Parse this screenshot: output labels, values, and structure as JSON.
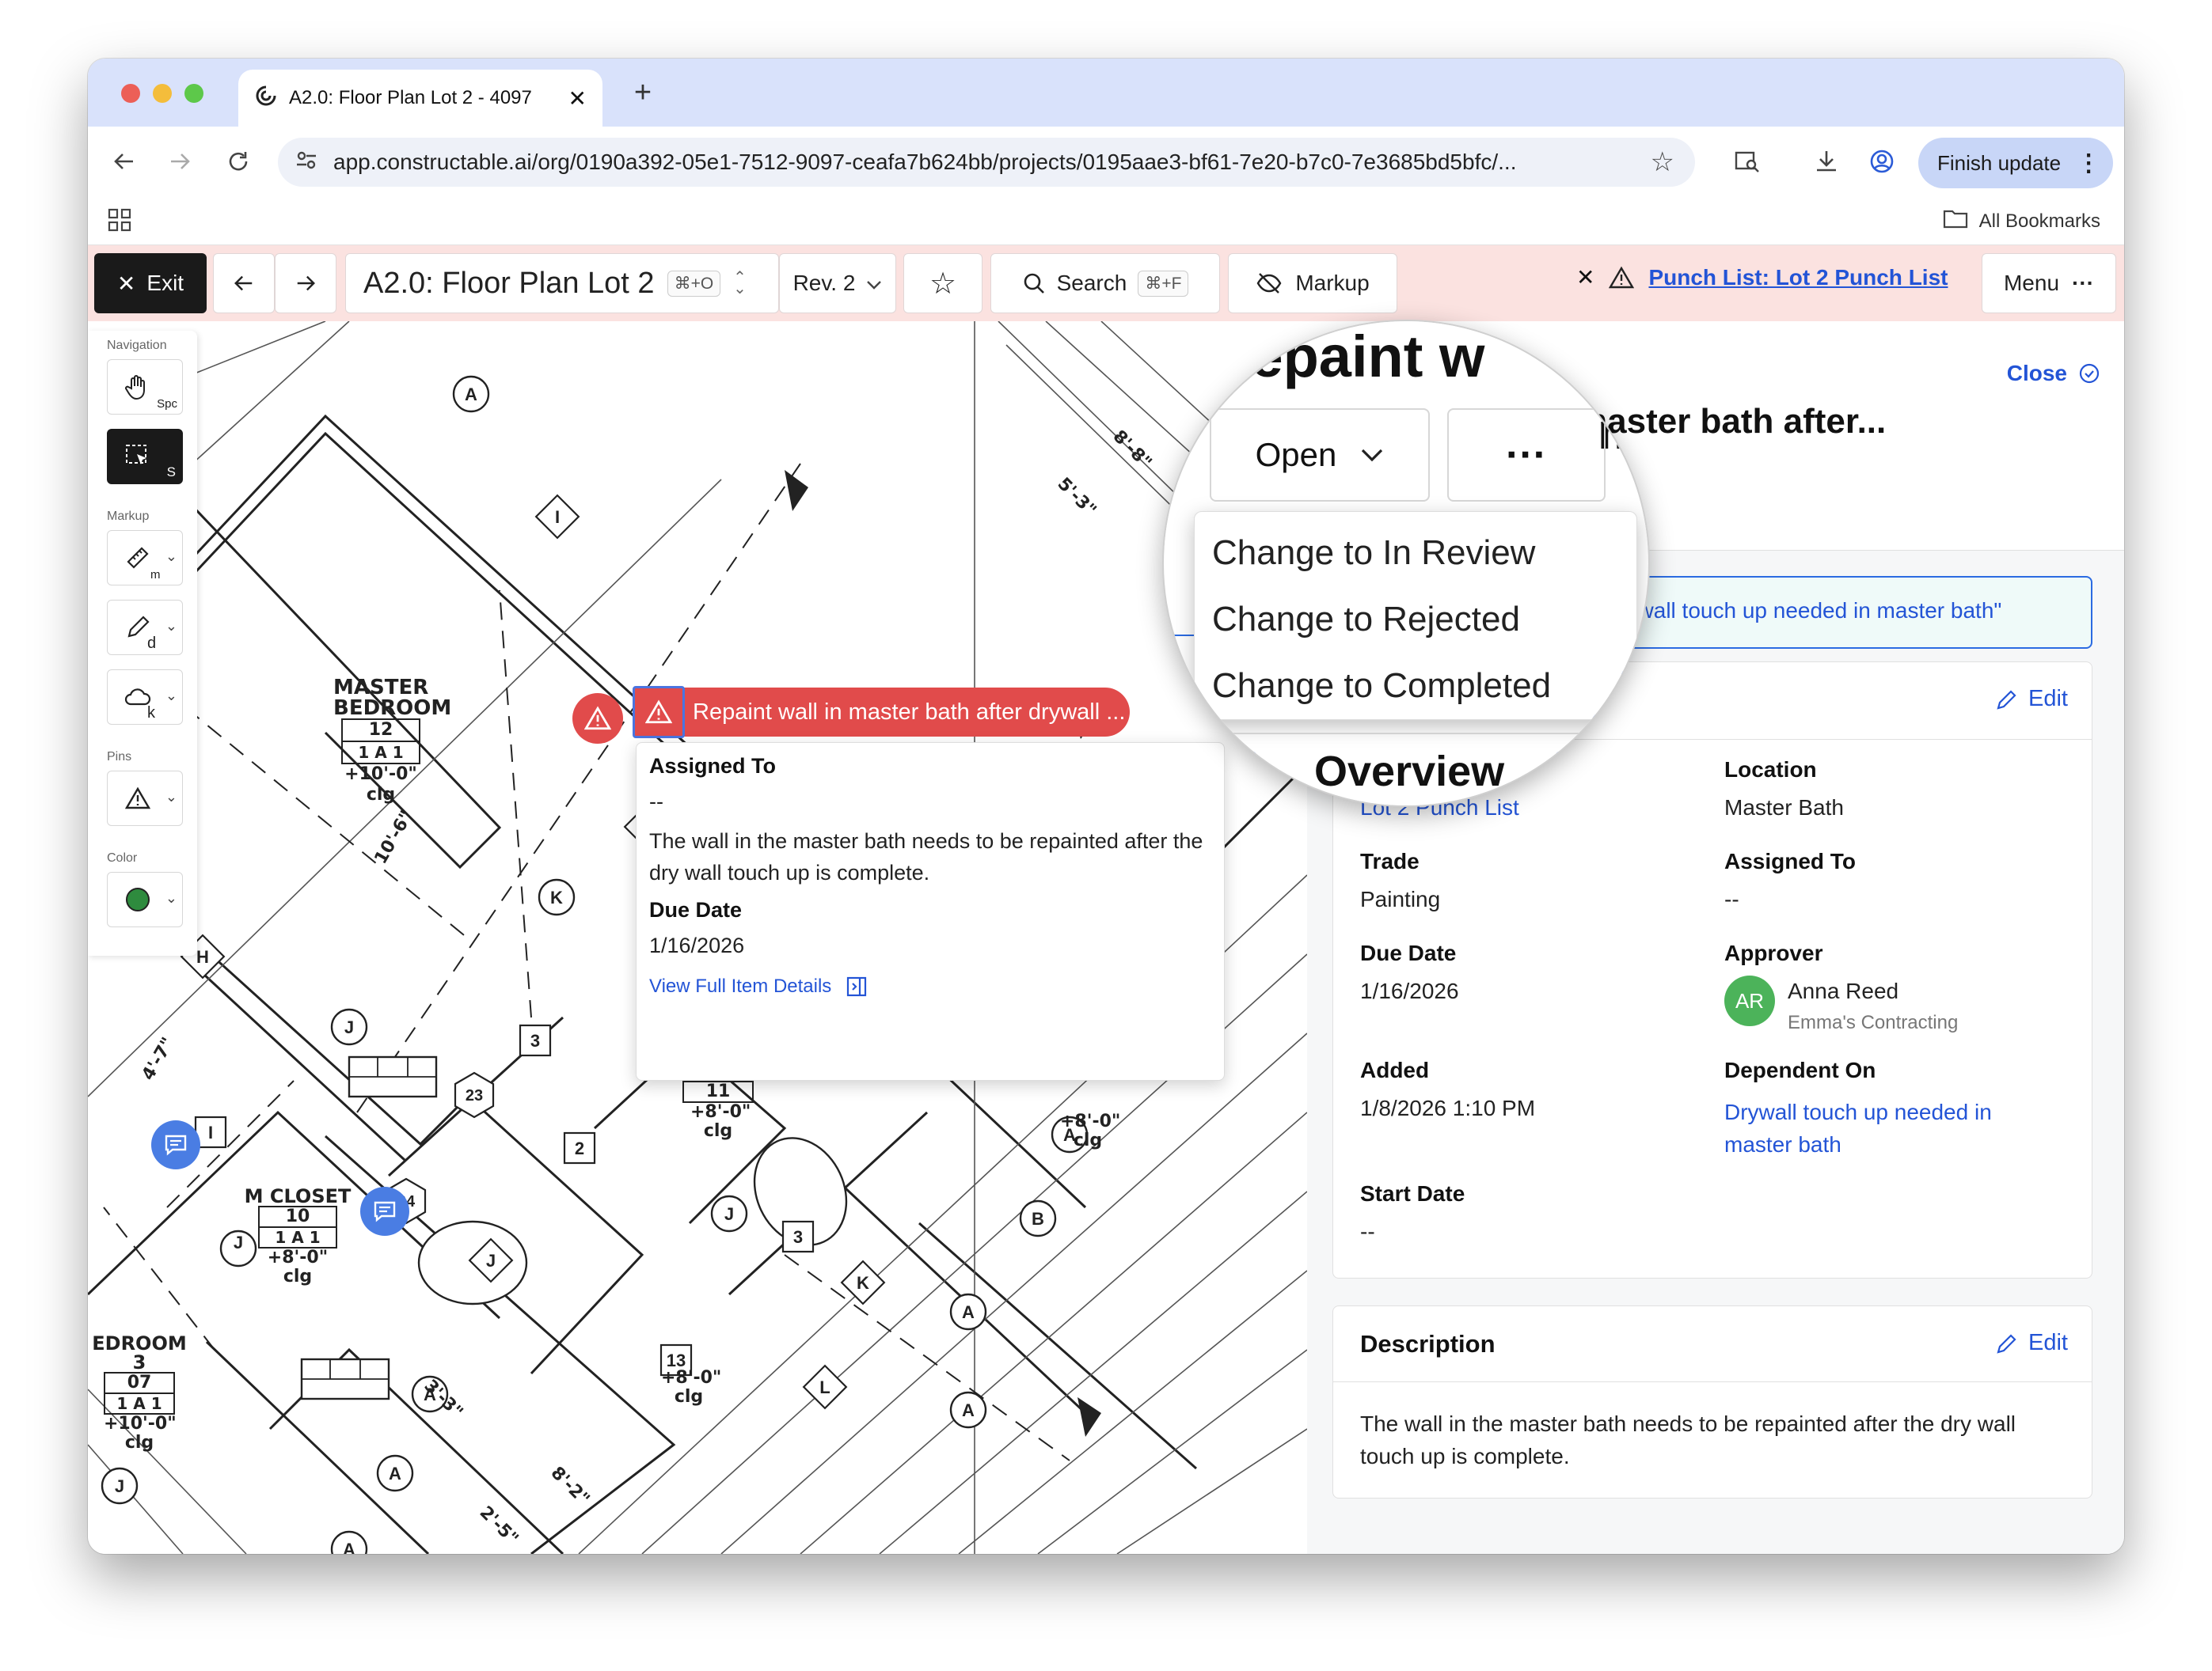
{
  "browser": {
    "tab_title": "A2.0: Floor Plan Lot 2 - 4097",
    "url": "app.constructable.ai/org/0190a392-05e1-7512-9097-ceafa7b624bb/projects/0195aae3-bf61-7e20-b7c0-7e3685bd5bfc/...",
    "finish_update_label": "Finish update",
    "all_bookmarks_label": "All Bookmarks"
  },
  "toolbar": {
    "exit_label": "Exit",
    "sheet_title": "A2.0: Floor Plan Lot 2",
    "sheet_shortcut": "⌘+O",
    "revision": "Rev. 2",
    "search_label": "Search",
    "search_shortcut": "⌘+F",
    "markup_label": "Markup",
    "punch_list_link": "Punch List: Lot 2 Punch List",
    "menu_label": "Menu"
  },
  "tool_rail": {
    "navigation_label": "Navigation",
    "pan_key": "Spc",
    "select_key": "S",
    "markup_label": "Markup",
    "measure_key": "m",
    "draw_key": "d",
    "cloud_key": "k",
    "pins_label": "Pins",
    "color_label": "Color",
    "current_color": "#2e8b3e"
  },
  "plan_labels": {
    "master_bedroom": "MASTER BEDROOM",
    "master_bedroom_num": "12",
    "master_bedroom_ceiling": "+10'-0\" clg",
    "m_closet": "M CLOSET",
    "m_closet_num": "10",
    "m_closet_ceiling": "+8'-0\" clg",
    "bedroom3": "EDROOM 3",
    "bedroom3_num": "07",
    "bedroom3_ceiling": "+10'-0\" clg",
    "bath_num": "11",
    "bath_ceiling": "+8'-0\" clg",
    "wc_num": "13",
    "wc_ceiling": "+8'-0\" clg",
    "right_ceiling": "+8'-0\" clg",
    "dim_a": "8'-8\"",
    "dim_b": "5'-3\"",
    "dim_c": "3'-3\"",
    "dim_d": "8'-2\"",
    "dim_e": "2'-5\"",
    "dim_f": "10'-6\"",
    "dim_g": "4'-7\""
  },
  "pin_popup": {
    "chip_title": "Repaint wall in master bath after drywall ...",
    "assigned_label": "Assigned To",
    "assigned_value": "--",
    "description": "The wall in the master bath needs to be repainted after the dry wall touch up is complete.",
    "due_label": "Due Date",
    "due_value": "1/16/2026",
    "view_details": "View Full Item Details"
  },
  "panel": {
    "title_partial": "Repaint w",
    "subtitle_partial": "master bath after...",
    "close_label": "Close",
    "dependency_banner": "Drywall touch up needed in master bath\"",
    "dependency_partial": "er",
    "status": "Open",
    "overview": {
      "heading": "Overview",
      "edit_label": "Edit",
      "punch_list_value": "Lot 2 Punch List",
      "location_label": "Location",
      "location_value": "Master Bath",
      "trade_label": "Trade",
      "trade_value": "Painting",
      "assigned_label": "Assigned To",
      "assigned_value": "--",
      "due_label": "Due Date",
      "due_value": "1/16/2026",
      "approver_label": "Approver",
      "approver_initials": "AR",
      "approver_name": "Anna Reed",
      "approver_company": "Emma's Contracting",
      "added_label": "Added",
      "added_value": "1/8/2026 1:10 PM",
      "dependent_label": "Dependent On",
      "dependent_value": "Drywall touch up needed in master bath",
      "start_label": "Start Date",
      "start_value": "--"
    },
    "description": {
      "heading": "Description",
      "edit_label": "Edit",
      "text": "The wall in the master bath needs to be repainted after the dry wall touch up is complete."
    }
  },
  "status_menu": {
    "items": [
      "Change to In Review",
      "Change to Rejected",
      "Change to Completed"
    ]
  }
}
